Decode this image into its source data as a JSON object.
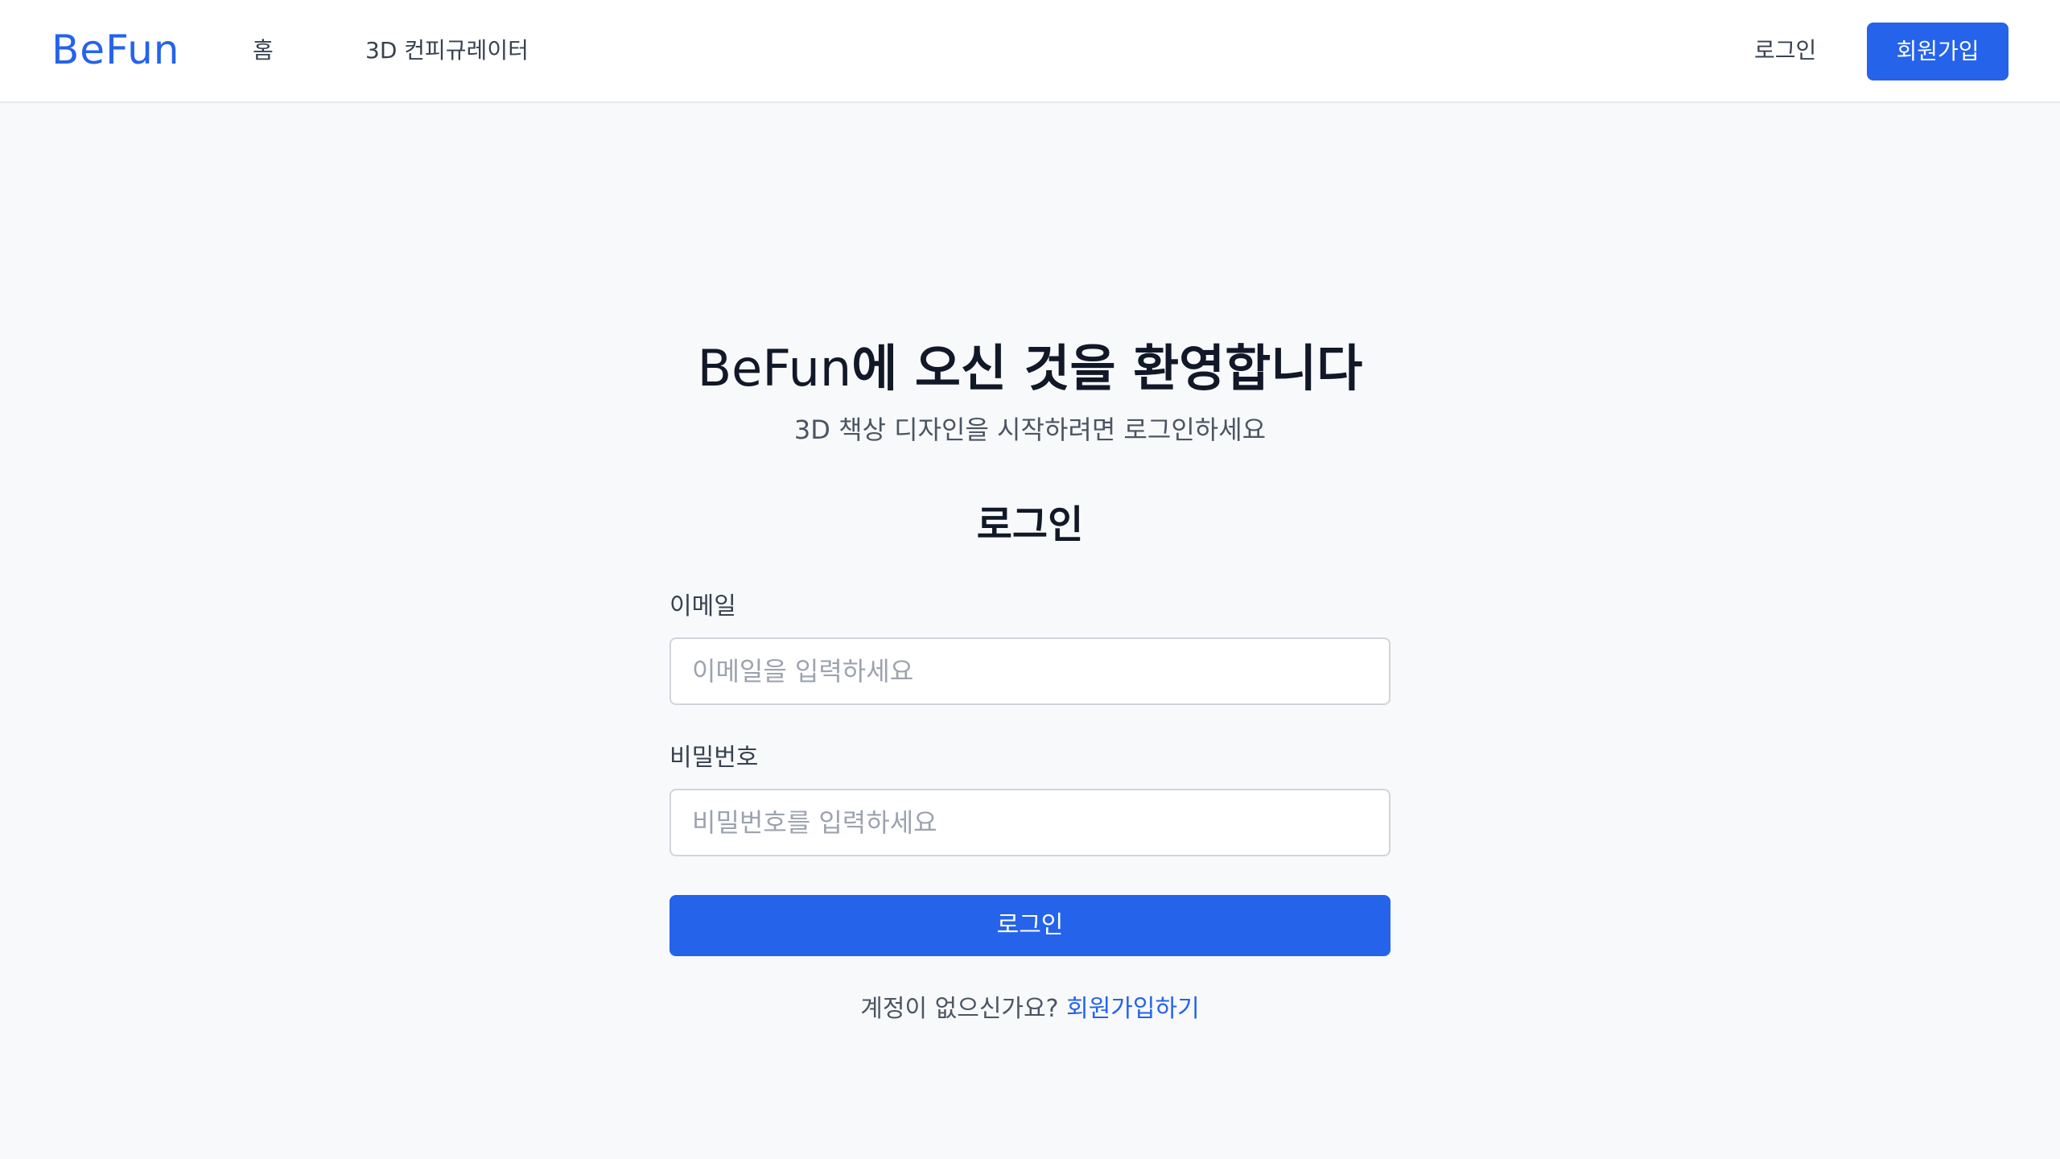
{
  "header": {
    "logo": "BeFun",
    "nav": {
      "home": "홈",
      "configurator": "3D 컨피규레이터"
    },
    "login_label": "로그인",
    "signup_label": "회원가입"
  },
  "hero": {
    "title_brand": "BeFun",
    "title_rest": "에 오신 것을 환영합니다",
    "subtitle": "3D 책상 디자인을 시작하려면 로그인하세요"
  },
  "form": {
    "heading": "로그인",
    "email": {
      "label": "이메일",
      "placeholder": "이메일을 입력하세요",
      "value": ""
    },
    "password": {
      "label": "비밀번호",
      "placeholder": "비밀번호를 입력하세요",
      "value": ""
    },
    "submit_label": "로그인"
  },
  "footer": {
    "prompt": "계정이 없으신가요?",
    "signup_link": "회원가입하기"
  },
  "colors": {
    "accent": "#2563eb",
    "background": "#f8f9fb",
    "header_bg": "#ffffff"
  }
}
